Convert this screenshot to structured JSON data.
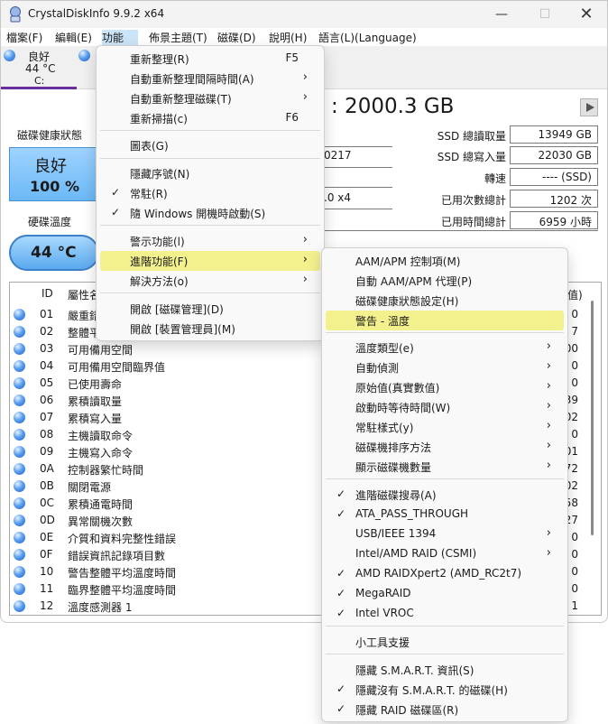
{
  "window": {
    "title": "CrystalDiskInfo 9.9.2 x64",
    "min_icon": "—",
    "max_icon": "☐",
    "close_icon": "✕"
  },
  "menubar": {
    "file": "檔案(F)",
    "edit": "編輯(E)",
    "function": "功能(u)",
    "theme": "佈景主題(T)",
    "disk": "磁碟(D)",
    "help": "說明(H)",
    "language": "語言(L)(Language)"
  },
  "drive": {
    "status": "良好",
    "temp": "44 °C",
    "letter": "C:"
  },
  "main": {
    "capacity": ": 2000.3 GB",
    "health_label": "磁碟健康狀態",
    "health_status": "良好",
    "health_pct": "100 %",
    "temp_label": "硬碟溫度",
    "temp_value": "44 °C",
    "partial_fields": [
      "0217",
      ".0 x4"
    ]
  },
  "stats": [
    {
      "label": "SSD 總讀取量",
      "value": "13949 GB"
    },
    {
      "label": "SSD 總寫入量",
      "value": "22030 GB"
    },
    {
      "label": "轉速",
      "value": "---- (SSD)"
    },
    {
      "label": "已用次數總計",
      "value": "1202 次"
    },
    {
      "label": "已用時間總計",
      "value": "6959 小時"
    }
  ],
  "table": {
    "headers": [
      "ID",
      "屬性名",
      "值)"
    ],
    "rows": [
      {
        "id": "01",
        "attr": "嚴重錯",
        "val": "0"
      },
      {
        "id": "02",
        "attr": "整體平",
        "val": "7"
      },
      {
        "id": "03",
        "attr": "可用備用空間",
        "val": "00"
      },
      {
        "id": "04",
        "attr": "可用備用空間臨界值",
        "val": "0"
      },
      {
        "id": "05",
        "attr": "已使用壽命",
        "val": "0"
      },
      {
        "id": "06",
        "attr": "累積讀取量",
        "val": "39"
      },
      {
        "id": "07",
        "attr": "累積寫入量",
        "val": "02"
      },
      {
        "id": "08",
        "attr": "主機讀取命令",
        "val": "0"
      },
      {
        "id": "09",
        "attr": "主機寫入命令",
        "val": "01"
      },
      {
        "id": "0A",
        "attr": "控制器繁忙時間",
        "val": "72"
      },
      {
        "id": "0B",
        "attr": "關閉電源",
        "val": "02"
      },
      {
        "id": "0C",
        "attr": "累積通電時間",
        "val": "58"
      },
      {
        "id": "0D",
        "attr": "異常關機次數",
        "val": "27"
      },
      {
        "id": "0E",
        "attr": "介質和資料完整性錯誤",
        "val": "0"
      },
      {
        "id": "0F",
        "attr": "錯誤資訊記錄項目數",
        "val": "0"
      },
      {
        "id": "10",
        "attr": "警告整體平均溫度時間",
        "val": "0"
      },
      {
        "id": "11",
        "attr": "臨界整體平均溫度時間",
        "val": "0"
      },
      {
        "id": "12",
        "attr": "溫度感測器 1",
        "val": "1"
      }
    ]
  },
  "function_menu": {
    "items": [
      {
        "label": "重新整理(R)",
        "shortcut": "F5"
      },
      {
        "label": "自動重新整理間隔時間(A)",
        "arrow": "›"
      },
      {
        "label": "自動重新整理磁碟(T)",
        "arrow": "›"
      },
      {
        "label": "重新掃描(c)",
        "shortcut": "F6"
      },
      {
        "label": "圖表(G)"
      },
      {
        "label": "隱藏序號(N)"
      },
      {
        "label": "常駐(R)",
        "check": "✓"
      },
      {
        "label": "隨 Windows 開機時啟動(S)",
        "check": "✓"
      },
      {
        "label": "警示功能(l)",
        "arrow": "›"
      },
      {
        "label": "進階功能(F)",
        "arrow": "›"
      },
      {
        "label": "解決方法(o)",
        "arrow": "›"
      },
      {
        "label": "開啟 [磁碟管理](D)"
      },
      {
        "label": "開啟 [裝置管理員](M)"
      }
    ]
  },
  "advanced_menu": {
    "items": [
      {
        "label": "AAM/APM 控制項(M)"
      },
      {
        "label": "自動 AAM/APM 代理(P)"
      },
      {
        "label": "磁碟健康狀態設定(H)"
      },
      {
        "label": "警告 - 溫度"
      },
      {
        "label": "溫度類型(e)",
        "arrow": "›"
      },
      {
        "label": "自動偵測",
        "arrow": "›"
      },
      {
        "label": "原始值(真實數值)",
        "arrow": "›"
      },
      {
        "label": "啟動時等待時間(W)",
        "arrow": "›"
      },
      {
        "label": "常駐樣式(y)",
        "arrow": "›"
      },
      {
        "label": "磁碟機排序方法",
        "arrow": "›"
      },
      {
        "label": "顯示磁碟機數量",
        "arrow": "›"
      },
      {
        "label": "進階磁碟搜尋(A)",
        "check": "✓"
      },
      {
        "label": "ATA_PASS_THROUGH",
        "check": "✓"
      },
      {
        "label": "USB/IEEE 1394",
        "arrow": "›"
      },
      {
        "label": "Intel/AMD RAID (CSMI)",
        "arrow": "›"
      },
      {
        "label": "AMD RAIDXpert2 (AMD_RC2t7)",
        "check": "✓"
      },
      {
        "label": "MegaRAID",
        "check": "✓"
      },
      {
        "label": "Intel VROC",
        "check": "✓"
      },
      {
        "label": "小工具支援"
      },
      {
        "label": "隱藏 S.M.A.R.T. 資訊(S)"
      },
      {
        "label": "隱藏沒有 S.M.A.R.T. 的磁碟(H)",
        "check": "✓"
      },
      {
        "label": "隱藏 RAID 磁碟區(R)",
        "check": "✓"
      }
    ]
  },
  "colors": {
    "highlight": "#f3f08e",
    "menu_bg": "#f9f9f9",
    "health_blue": "#6cb9f6",
    "tab_accent": "#6a2ea0"
  }
}
